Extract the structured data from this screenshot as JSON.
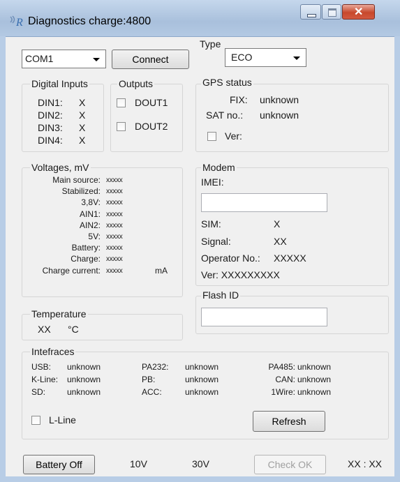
{
  "window": {
    "title": "Diagnostics charge:4800",
    "icon": "app-icon"
  },
  "toolbar": {
    "port": "COM1",
    "connect_label": "Connect"
  },
  "type": {
    "legend": "Type",
    "value": "ECO"
  },
  "digital_inputs": {
    "legend": "Digital Inputs",
    "items": [
      {
        "label": "DIN1:",
        "value": "X"
      },
      {
        "label": "DIN2:",
        "value": "X"
      },
      {
        "label": "DIN3:",
        "value": "X"
      },
      {
        "label": "DIN4:",
        "value": "X"
      }
    ]
  },
  "outputs": {
    "legend": "Outputs",
    "items": [
      {
        "label": "DOUT1"
      },
      {
        "label": "DOUT2"
      }
    ]
  },
  "gps": {
    "legend": "GPS status",
    "fix_label": "FIX:",
    "fix_value": "unknown",
    "sat_label": "SAT no.:",
    "sat_value": "unknown",
    "ver_label": "Ver:"
  },
  "voltages": {
    "legend": "Voltages, mV",
    "rows": [
      {
        "label": "Main source:",
        "value": "xxxxx"
      },
      {
        "label": "Stabilized:",
        "value": "xxxxx"
      },
      {
        "label": "3,8V:",
        "value": "xxxxx"
      },
      {
        "label": "AIN1:",
        "value": "xxxxx"
      },
      {
        "label": "AIN2:",
        "value": "xxxxx"
      },
      {
        "label": "5V:",
        "value": "xxxxx"
      },
      {
        "label": "Battery:",
        "value": "xxxxx"
      },
      {
        "label": "Charge:",
        "value": "xxxxx"
      },
      {
        "label": "Charge current:",
        "value": "xxxxx",
        "unit": "mA"
      }
    ]
  },
  "modem": {
    "legend": "Modem",
    "imei_label": "IMEI:",
    "imei_value": "",
    "sim_label": "SIM:",
    "sim_value": "X",
    "signal_label": "Signal:",
    "signal_value": "XX",
    "operator_label": "Operator No.:",
    "operator_value": "XXXXX",
    "ver_text": "Ver: XXXXXXXXX"
  },
  "flash": {
    "legend": "Flash ID",
    "value": ""
  },
  "temperature": {
    "legend": "Temperature",
    "value": "XX",
    "unit": "°C"
  },
  "interfaces": {
    "legend": "Intefraces",
    "col1": [
      {
        "label": "USB:",
        "value": "unknown"
      },
      {
        "label": "K-Line:",
        "value": "unknown"
      },
      {
        "label": "SD:",
        "value": "unknown"
      }
    ],
    "col2": [
      {
        "label": "PA232:",
        "value": "unknown"
      },
      {
        "label": "PB:",
        "value": "unknown"
      },
      {
        "label": "ACC:",
        "value": "unknown"
      }
    ],
    "col3": [
      {
        "label": "PA485:",
        "value": "unknown"
      },
      {
        "label": "CAN:",
        "value": "unknown"
      },
      {
        "label": "1Wire:",
        "value": "unknown"
      }
    ],
    "lline_label": "L-Line",
    "refresh_label": "Refresh"
  },
  "footer": {
    "battery_off_label": "Battery Off",
    "v10": "10V",
    "v30": "30V",
    "check_ok_label": "Check OK",
    "time": "XX : XX"
  },
  "colors": {
    "client_bg": "#f0f0f0",
    "close_button": "#c7482c",
    "titlebar": "#b3c9e3"
  }
}
